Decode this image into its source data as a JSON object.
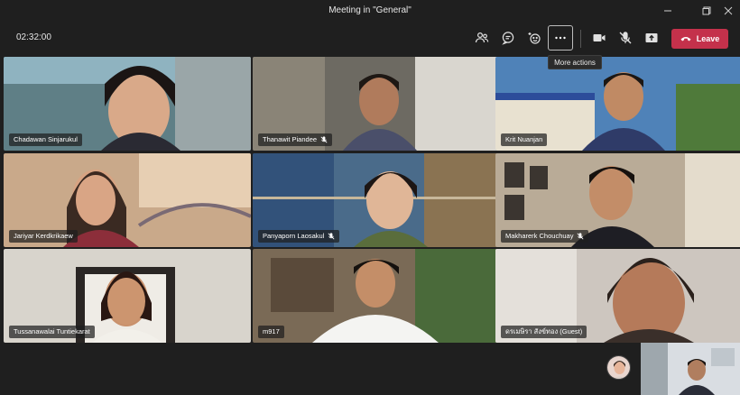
{
  "window": {
    "title": "Meeting in \"General\"",
    "controls": [
      "minimize",
      "maximize",
      "close"
    ]
  },
  "toolbar": {
    "timer": "02:32:00",
    "buttons": [
      {
        "name": "participants",
        "icon": "people-icon"
      },
      {
        "name": "chat",
        "icon": "chat-icon"
      },
      {
        "name": "reactions",
        "icon": "reactions-icon"
      },
      {
        "name": "more-actions",
        "icon": "more-icon",
        "active": true
      },
      {
        "name": "camera",
        "icon": "camera-icon"
      },
      {
        "name": "mic",
        "icon": "mic-off-icon"
      },
      {
        "name": "share",
        "icon": "share-icon"
      }
    ],
    "leave_label": "Leave",
    "tooltip": "More actions"
  },
  "participants": [
    {
      "name": "Chadawan Sinjarukul",
      "muted": false,
      "bg": "#5f7f86"
    },
    {
      "name": "Thanawit Piandee",
      "muted": true,
      "bg": "#6d6a62"
    },
    {
      "name": "Krit Nuanjan",
      "muted": false,
      "bg": "#4f82b8"
    },
    {
      "name": "Jariyar Kerdkrikaew",
      "muted": false,
      "bg": "#c9a98a"
    },
    {
      "name": "Panyaporn Laosakul",
      "muted": true,
      "bg": "#4a6b8a"
    },
    {
      "name": "Makharerk Chouchuay",
      "muted": true,
      "bg": "#b9ab97"
    },
    {
      "name": "Tussanawalai Tuntiekarat",
      "muted": false,
      "bg": "#d8d4cc"
    },
    {
      "name": "m917",
      "muted": false,
      "bg": "#7a6a56"
    },
    {
      "name": "ดรเมษิรา สังข์ทอง (Guest)",
      "muted": false,
      "bg": "#cdc6bf"
    }
  ],
  "colors": {
    "background": "#1f1f1f",
    "leave": "#c4314b",
    "nametag": "#1e1e1e"
  }
}
